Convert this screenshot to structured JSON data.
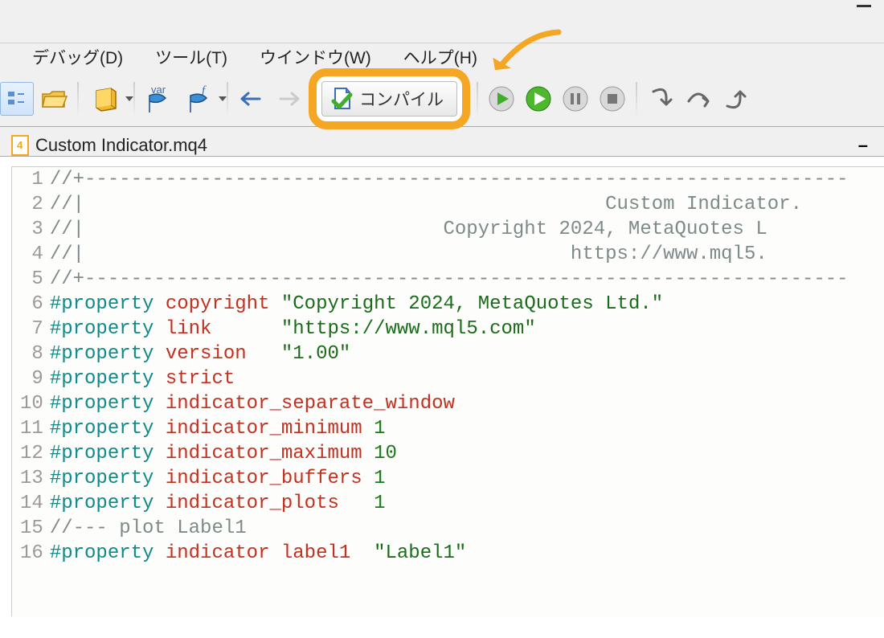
{
  "menubar": {
    "debug": "デバッグ(D)",
    "tools": "ツール(T)",
    "window": "ウインドウ(W)",
    "help": "ヘルプ(H)"
  },
  "toolbar": {
    "compile_label": "コンパイル"
  },
  "tab": {
    "filename": "Custom Indicator.mq4"
  },
  "code": {
    "lines": [
      [
        {
          "cls": "tok-comment",
          "t": "//+------------------------------------------------------------------"
        }
      ],
      [
        {
          "cls": "tok-comment",
          "t": "//|                                             Custom Indicator."
        }
      ],
      [
        {
          "cls": "tok-comment",
          "t": "//|                               Copyright 2024, MetaQuotes L"
        }
      ],
      [
        {
          "cls": "tok-comment",
          "t": "//|                                          https://www.mql5."
        }
      ],
      [
        {
          "cls": "tok-comment",
          "t": "//+------------------------------------------------------------------"
        }
      ],
      [
        {
          "cls": "tok-teal",
          "t": "#property"
        },
        {
          "cls": "",
          "t": " "
        },
        {
          "cls": "tok-red",
          "t": "copyright"
        },
        {
          "cls": "",
          "t": " "
        },
        {
          "cls": "tok-string",
          "t": "\"Copyright 2024, MetaQuotes Ltd.\""
        }
      ],
      [
        {
          "cls": "tok-teal",
          "t": "#property"
        },
        {
          "cls": "",
          "t": " "
        },
        {
          "cls": "tok-red",
          "t": "link"
        },
        {
          "cls": "",
          "t": "      "
        },
        {
          "cls": "tok-string",
          "t": "\"https://www.mql5.com\""
        }
      ],
      [
        {
          "cls": "tok-teal",
          "t": "#property"
        },
        {
          "cls": "",
          "t": " "
        },
        {
          "cls": "tok-red",
          "t": "version"
        },
        {
          "cls": "",
          "t": "   "
        },
        {
          "cls": "tok-string",
          "t": "\"1.00\""
        }
      ],
      [
        {
          "cls": "tok-teal",
          "t": "#property"
        },
        {
          "cls": "",
          "t": " "
        },
        {
          "cls": "tok-red",
          "t": "strict"
        }
      ],
      [
        {
          "cls": "tok-teal",
          "t": "#property"
        },
        {
          "cls": "",
          "t": " "
        },
        {
          "cls": "tok-red",
          "t": "indicator_separate_window"
        }
      ],
      [
        {
          "cls": "tok-teal",
          "t": "#property"
        },
        {
          "cls": "",
          "t": " "
        },
        {
          "cls": "tok-red",
          "t": "indicator_minimum"
        },
        {
          "cls": "",
          "t": " "
        },
        {
          "cls": "tok-green",
          "t": "1"
        }
      ],
      [
        {
          "cls": "tok-teal",
          "t": "#property"
        },
        {
          "cls": "",
          "t": " "
        },
        {
          "cls": "tok-red",
          "t": "indicator_maximum"
        },
        {
          "cls": "",
          "t": " "
        },
        {
          "cls": "tok-green",
          "t": "10"
        }
      ],
      [
        {
          "cls": "tok-teal",
          "t": "#property"
        },
        {
          "cls": "",
          "t": " "
        },
        {
          "cls": "tok-red",
          "t": "indicator_buffers"
        },
        {
          "cls": "",
          "t": " "
        },
        {
          "cls": "tok-green",
          "t": "1"
        }
      ],
      [
        {
          "cls": "tok-teal",
          "t": "#property"
        },
        {
          "cls": "",
          "t": " "
        },
        {
          "cls": "tok-red",
          "t": "indicator_plots"
        },
        {
          "cls": "",
          "t": "   "
        },
        {
          "cls": "tok-green",
          "t": "1"
        }
      ],
      [
        {
          "cls": "tok-comment",
          "t": "//--- plot Label1"
        }
      ],
      [
        {
          "cls": "tok-teal",
          "t": "#property"
        },
        {
          "cls": "",
          "t": " "
        },
        {
          "cls": "tok-red",
          "t": "indicator label1"
        },
        {
          "cls": "",
          "t": "  "
        },
        {
          "cls": "tok-string",
          "t": "\"Label1\""
        }
      ]
    ]
  }
}
